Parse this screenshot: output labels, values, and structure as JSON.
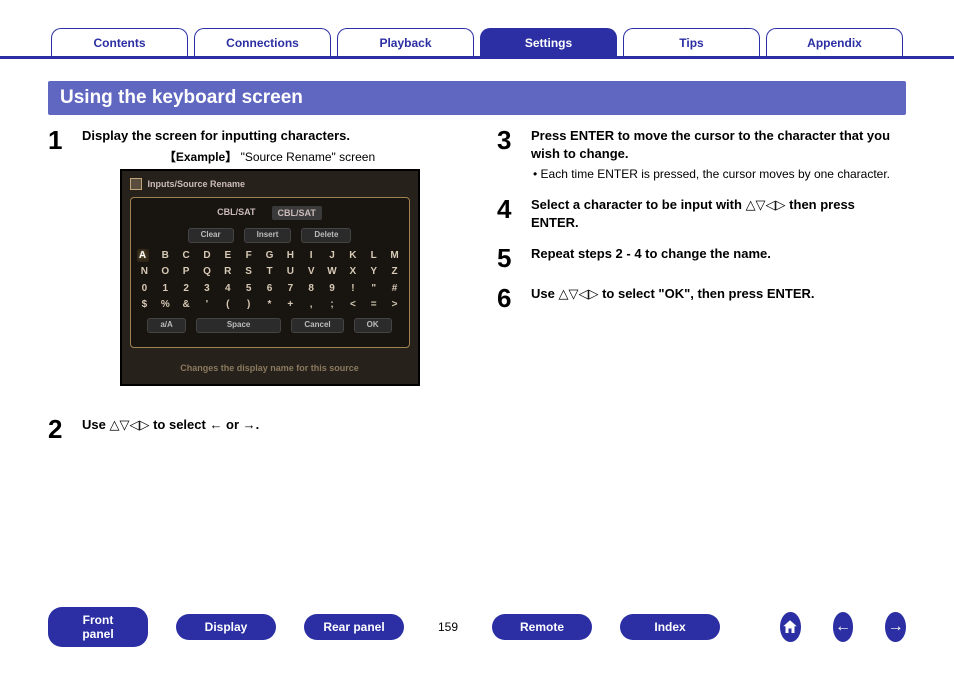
{
  "topnav": {
    "tabs": [
      {
        "label": "Contents",
        "active": false
      },
      {
        "label": "Connections",
        "active": false
      },
      {
        "label": "Playback",
        "active": false
      },
      {
        "label": "Settings",
        "active": true
      },
      {
        "label": "Tips",
        "active": false
      },
      {
        "label": "Appendix",
        "active": false
      }
    ]
  },
  "section_header": "Using the keyboard screen",
  "col_left": {
    "step1": {
      "num": "1",
      "text": "Display the screen for inputting characters.",
      "example_prefix": "【Example】",
      "example_name": "\"Source Rename\" screen"
    },
    "step2": {
      "num": "2",
      "text_pre": "Use ",
      "arrows": "△▽◁▷",
      "text_mid": " to select ",
      "left_icon": "←",
      "or_text": " or ",
      "right_icon": "→",
      "text_post": "."
    }
  },
  "screen": {
    "title": "Inputs/Source Rename",
    "opt_a": "CBL/SAT",
    "opt_b": "CBL/SAT",
    "btn_clear": "Clear",
    "btn_insert": "Insert",
    "btn_delete": "Delete",
    "rows": [
      [
        "A",
        "B",
        "C",
        "D",
        "E",
        "F",
        "G",
        "H",
        "I",
        "J",
        "K",
        "L",
        "M"
      ],
      [
        "N",
        "O",
        "P",
        "Q",
        "R",
        "S",
        "T",
        "U",
        "V",
        "W",
        "X",
        "Y",
        "Z"
      ],
      [
        "0",
        "1",
        "2",
        "3",
        "4",
        "5",
        "6",
        "7",
        "8",
        "9",
        "!",
        "\"",
        "#"
      ],
      [
        "$",
        "%",
        "&",
        "'",
        "(",
        ")",
        "*",
        "+",
        ",",
        ";",
        "<",
        "=",
        ">"
      ]
    ],
    "btn_az": "a/A",
    "btn_space": "Space",
    "btn_cancel": "Cancel",
    "btn_ok": "OK",
    "footer": "Changes the display name for this source"
  },
  "col_right": {
    "step3": {
      "num": "3",
      "text": "Press ENTER to move the cursor to the character that you wish to change.",
      "note": "• Each time ENTER is pressed, the cursor moves by one character."
    },
    "step4": {
      "num": "4",
      "text_pre": "Select a character to be input with ",
      "arrows": "△▽◁▷",
      "text_post": " then press ENTER."
    },
    "step5": {
      "num": "5",
      "text": "Repeat steps 2 - 4 to change the name."
    },
    "step6": {
      "num": "6",
      "text_pre": "Use ",
      "arrows": "△▽◁▷",
      "text_post": " to select \"OK\", then press ENTER."
    }
  },
  "footer": {
    "pills": [
      "Front panel",
      "Display",
      "Rear panel"
    ],
    "page": "159",
    "pills2": [
      "Remote",
      "Index"
    ]
  }
}
